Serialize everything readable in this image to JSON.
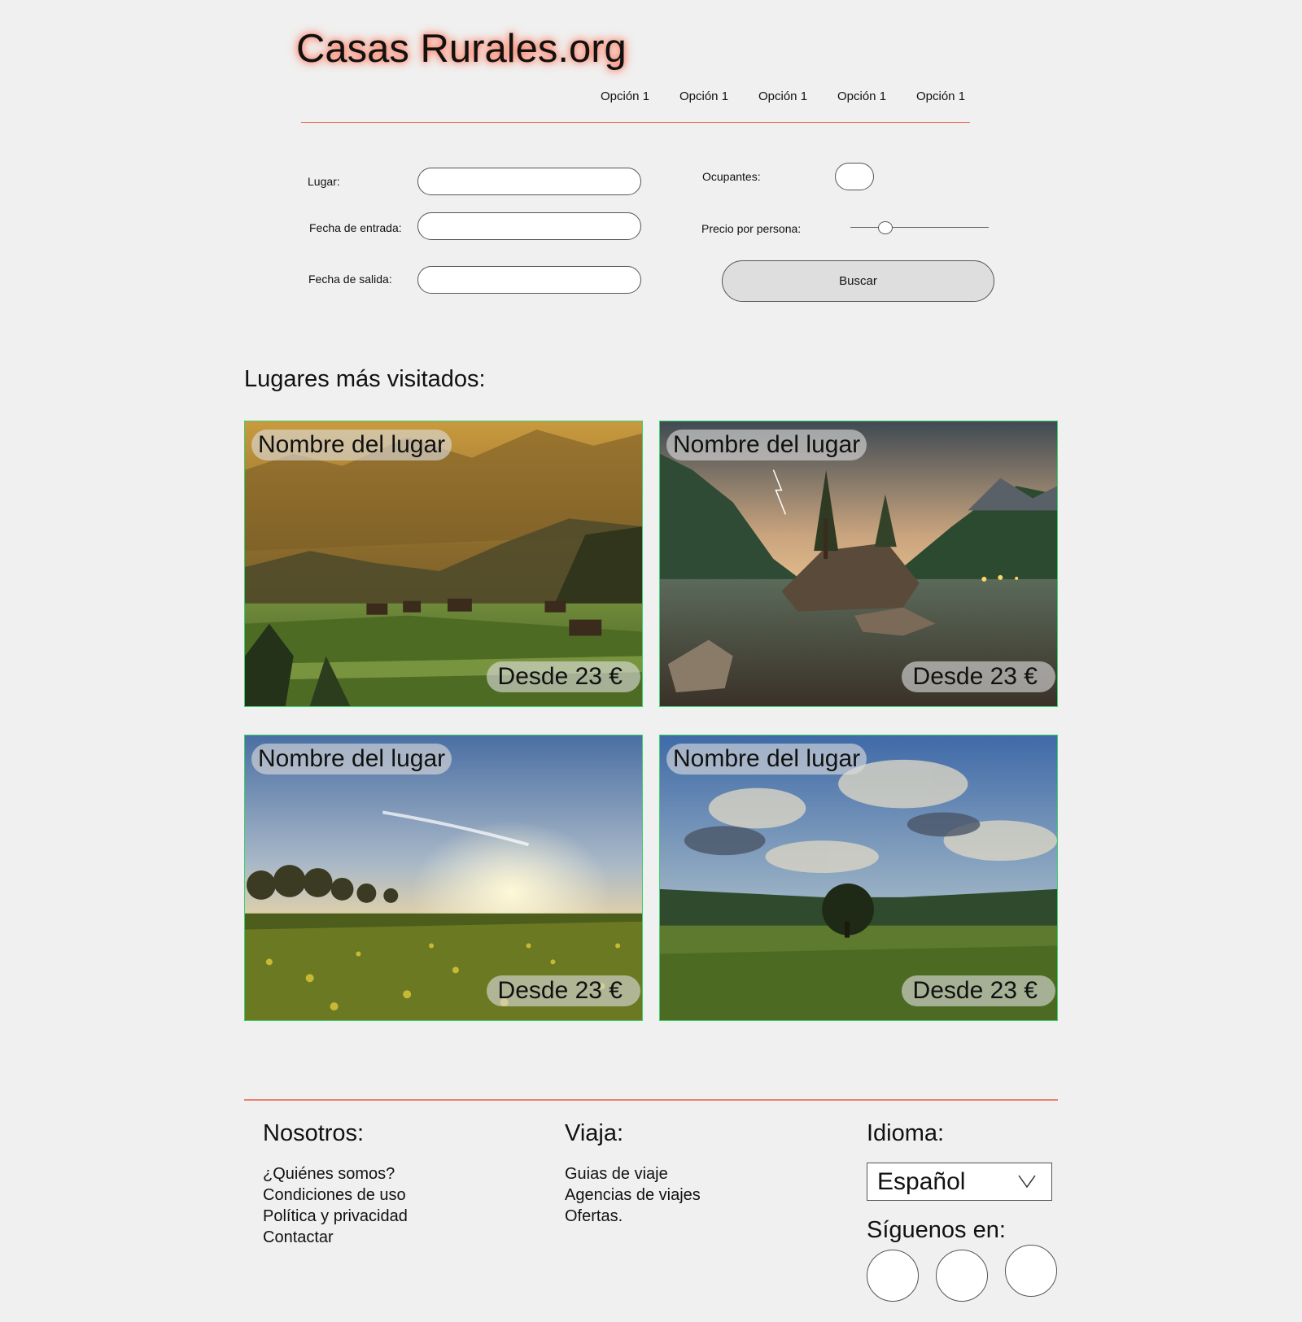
{
  "header": {
    "logo": "Casas Rurales.org",
    "nav": [
      "Opción 1",
      "Opción 1",
      "Opción 1",
      "Opción 1",
      "Opción 1"
    ]
  },
  "search": {
    "lugar_label": "Lugar:",
    "fecha_entrada_label": "Fecha de entrada:",
    "fecha_salida_label": "Fecha de salida:",
    "ocupantes_label": "Ocupantes:",
    "precio_label": "Precio por persona:",
    "precio_slider_fraction": 0.25,
    "buscar_label": "Buscar"
  },
  "places": {
    "title": "Lugares más visitados:",
    "cards": [
      {
        "name": "Nombre del lugar",
        "price": "Desde 23 €"
      },
      {
        "name": "Nombre del lugar",
        "price": "Desde 23 €"
      },
      {
        "name": "Nombre del lugar",
        "price": "Desde 23 €"
      },
      {
        "name": "Nombre del lugar",
        "price": "Desde 23 €"
      }
    ]
  },
  "footer": {
    "nosotros": {
      "title": "Nosotros:",
      "links": [
        "¿Quiénes somos?",
        "Condiciones de uso",
        "Política y privacidad",
        "Contactar"
      ]
    },
    "viaja": {
      "title": "Viaja:",
      "links": [
        "Guias de viaje",
        "Agencias de viajes",
        "Ofertas."
      ]
    },
    "idioma": {
      "title": "Idioma:",
      "selected": "Español"
    },
    "siguenos": {
      "title": "Síguenos en:"
    }
  },
  "colors": {
    "accent_line": "#e8735f",
    "card_border": "#3ccf6e",
    "background": "#f0f0f0"
  },
  "icons": [
    "chevron-down-icon"
  ]
}
